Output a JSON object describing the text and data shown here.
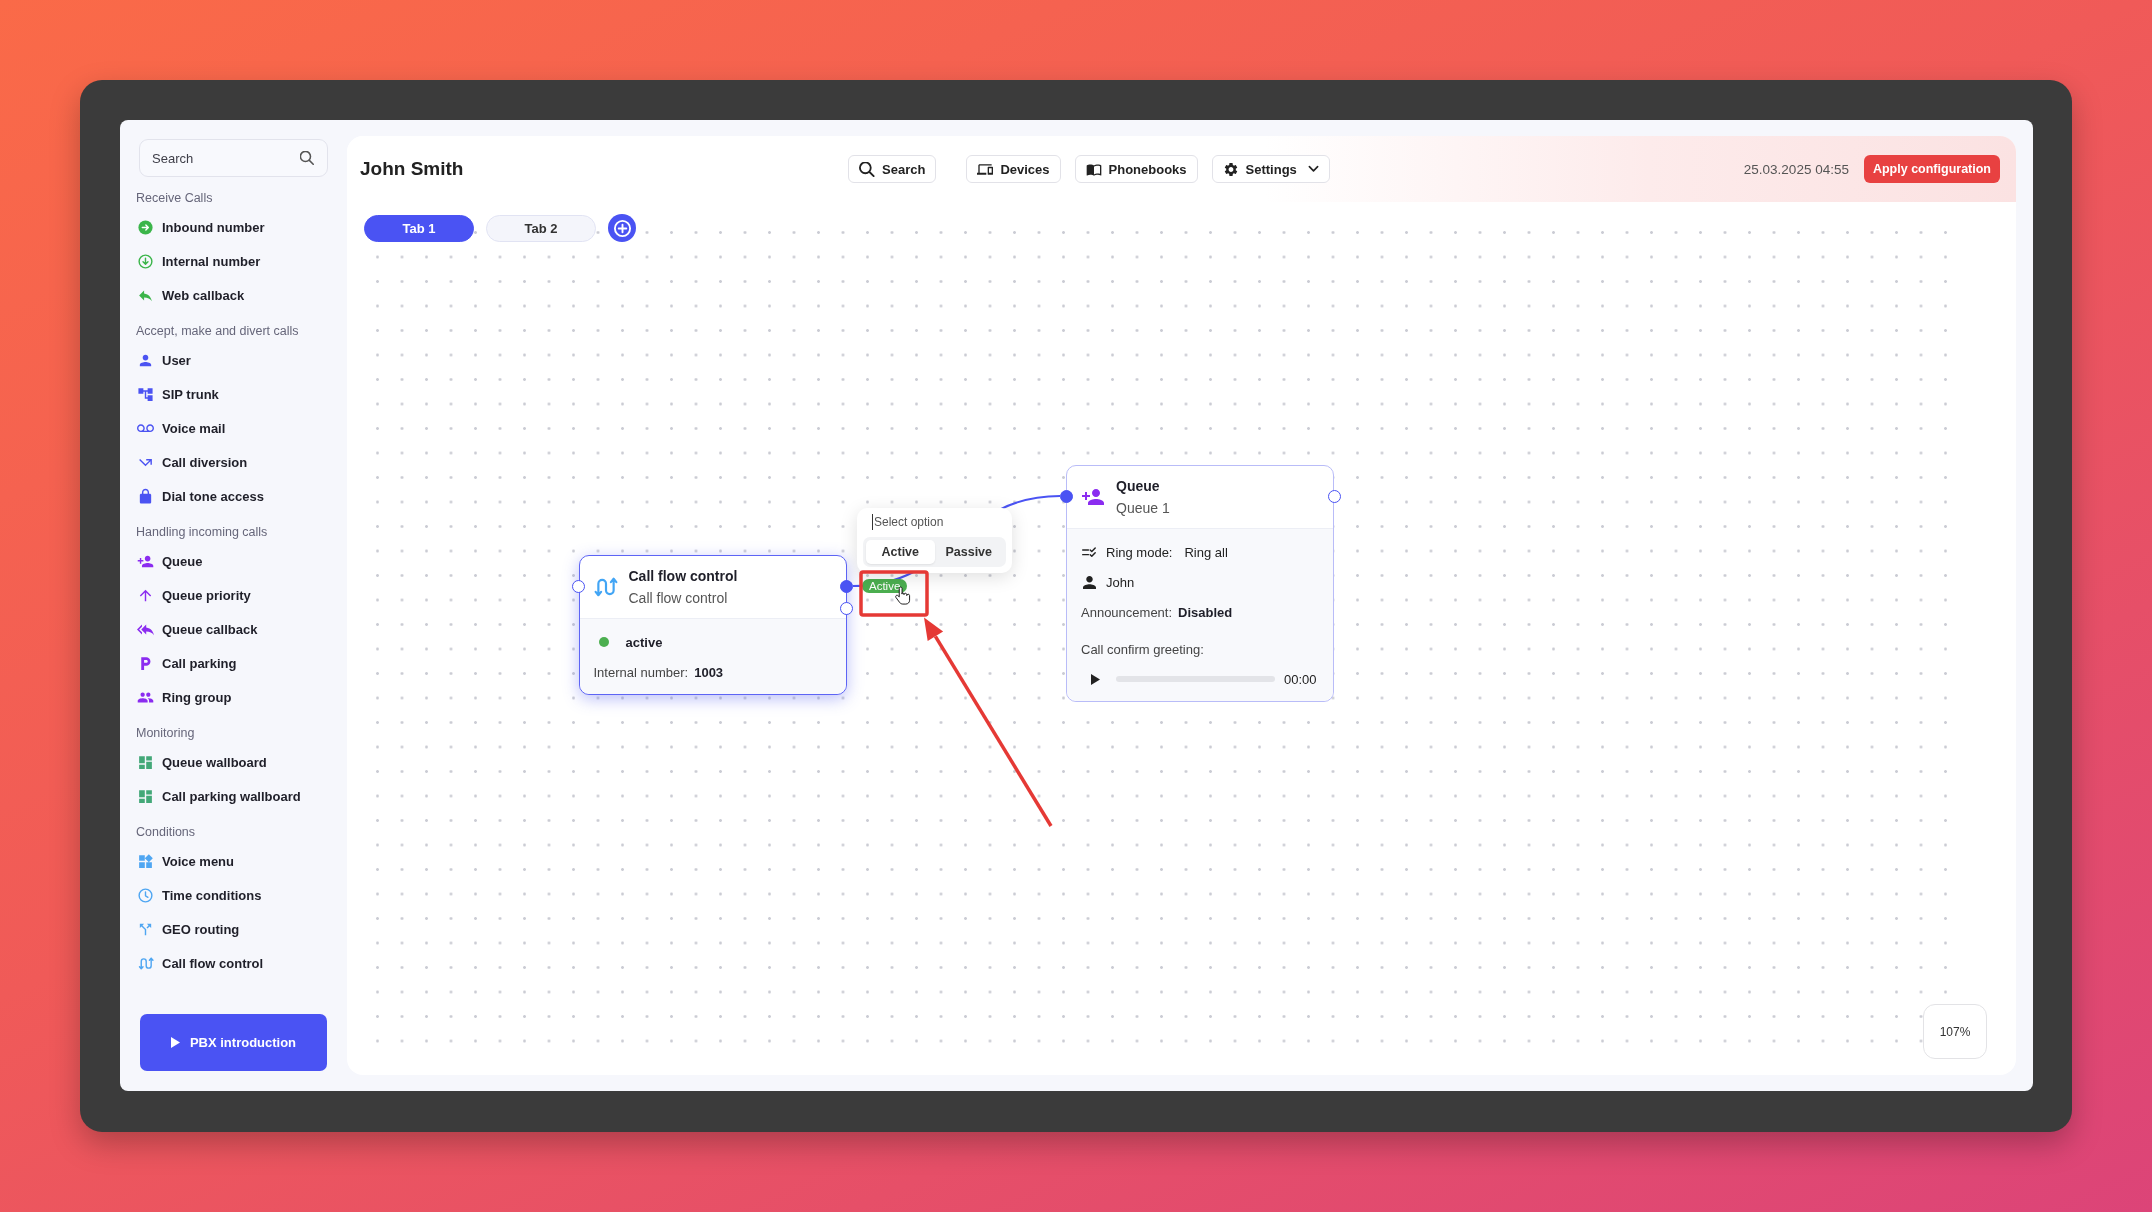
{
  "sidebar": {
    "search": {
      "placeholder": "Search"
    },
    "sections": [
      {
        "title": "Receive Calls",
        "items": [
          "Inbound number",
          "Internal number",
          "Web callback"
        ]
      },
      {
        "title": "Accept, make and divert calls",
        "items": [
          "User",
          "SIP trunk",
          "Voice mail",
          "Call diversion",
          "Dial tone access"
        ]
      },
      {
        "title": "Handling incoming calls",
        "items": [
          "Queue",
          "Queue priority",
          "Queue callback",
          "Call parking",
          "Ring group"
        ]
      },
      {
        "title": "Monitoring",
        "items": [
          "Queue wallboard",
          "Call parking wallboard"
        ]
      },
      {
        "title": "Conditions",
        "items": [
          "Voice menu",
          "Time conditions",
          "GEO routing",
          "Call flow control"
        ]
      }
    ],
    "intro_button": "PBX introduction"
  },
  "header": {
    "title": "John Smith",
    "toolbar": [
      {
        "label": "Search",
        "kind": "button"
      },
      {
        "label": "Devices",
        "kind": "button"
      },
      {
        "label": "Phonebooks",
        "kind": "button"
      },
      {
        "label": "Settings",
        "kind": "dropdown"
      }
    ],
    "datetime": "25.03.2025 04:55",
    "apply_button": "Apply configuration"
  },
  "tabs": [
    {
      "label": "Tab 1",
      "selected": true
    },
    {
      "label": "Tab 2",
      "selected": false
    }
  ],
  "canvas": {
    "nodes": [
      {
        "kind": "call_flow_control",
        "title": "Call flow control",
        "subtitle": "Call flow control",
        "selected": true,
        "inputs": [
          {
            "connected": false
          }
        ],
        "outputs": [
          {
            "connected": true
          },
          {
            "connected": false
          }
        ],
        "rows": [
          {
            "kind": "status",
            "text": "active",
            "on": true
          },
          {
            "kind": "field",
            "label": "Internal number:",
            "value": "1003"
          }
        ]
      },
      {
        "kind": "queue",
        "title": "Queue",
        "subtitle": "Queue 1",
        "selected": false,
        "inputs": [
          {
            "connected": true
          }
        ],
        "outputs": [
          {
            "connected": false
          }
        ],
        "rows": [
          {
            "kind": "icon_field",
            "label": "Ring mode:",
            "value": "Ring all"
          },
          {
            "kind": "person",
            "text": "John"
          },
          {
            "kind": "field",
            "label": "Announcement:",
            "value": "Disabled"
          },
          {
            "kind": "heading",
            "text": "Call confirm greeting:"
          },
          {
            "kind": "player",
            "time": "00:00"
          }
        ]
      }
    ],
    "connection": {
      "label": "Active"
    },
    "option_popup": {
      "placeholder": "Select option",
      "options": [
        {
          "label": "Active",
          "selected": true
        },
        {
          "label": "Passive",
          "selected": false
        }
      ]
    },
    "zoom": "107%"
  }
}
